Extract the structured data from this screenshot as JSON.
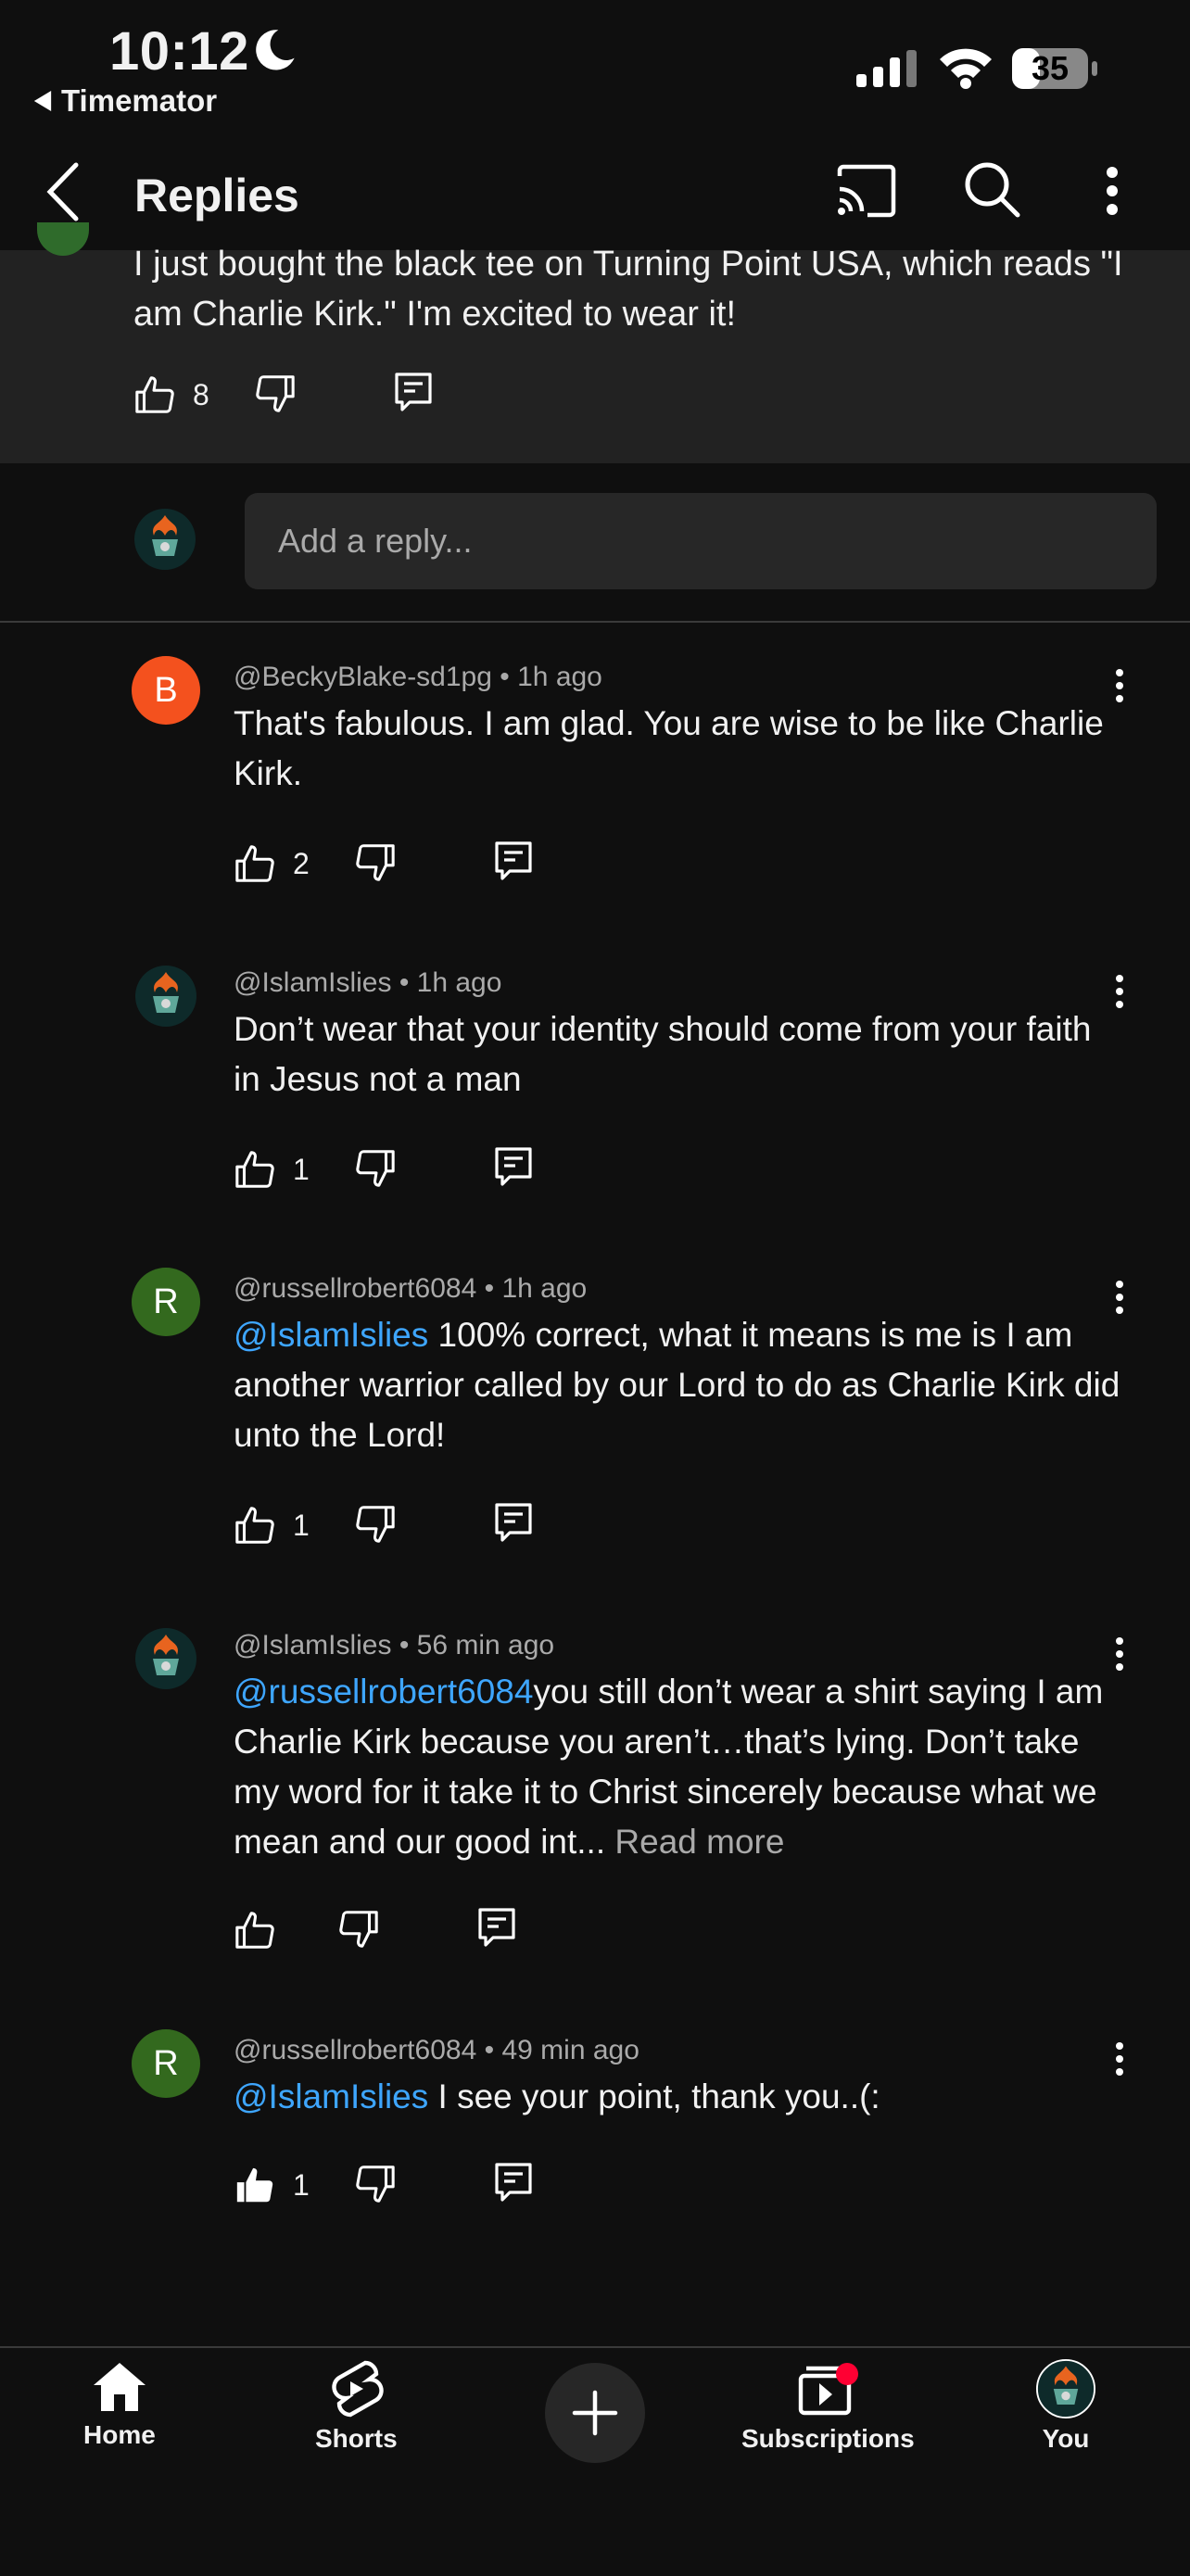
{
  "status_bar": {
    "time": "10:12",
    "back_app": "Timemator",
    "battery": "35"
  },
  "header": {
    "title": "Replies"
  },
  "parent_comment": {
    "text": "I just bought the black tee on Turning Point USA, which reads \"I am Charlie Kirk.\" I'm excited to wear it!",
    "likes": "8"
  },
  "reply_input": {
    "placeholder": "Add a reply..."
  },
  "replies": [
    {
      "avatar_letter": "B",
      "avatar_color": "#f4511e",
      "handle": "@BeckyBlake-sd1pg",
      "time": "1h ago",
      "mention": "",
      "text": "That's fabulous.  I am glad. You  are wise to be like Charlie Kirk.",
      "read_more": "",
      "likes": "2",
      "liked": false
    },
    {
      "avatar_letter": "",
      "avatar_color": "",
      "handle": "@IslamIslies",
      "time": "1h ago",
      "mention": "",
      "text": "Don’t wear that your identity should come from your faith in Jesus not a man",
      "read_more": "",
      "likes": "1",
      "liked": false
    },
    {
      "avatar_letter": "R",
      "avatar_color": "#33691e",
      "handle": "@russellrobert6084",
      "time": "1h ago",
      "mention": "@IslamIslies",
      "text": " 100% correct, what it means is me is I am another warrior called by our Lord to do as Charlie Kirk did unto the Lord!",
      "read_more": "",
      "likes": "1",
      "liked": false
    },
    {
      "avatar_letter": "",
      "avatar_color": "",
      "handle": "@IslamIslies",
      "time": "56 min ago",
      "mention": "@russellrobert6084",
      "text": "you still don’t wear a shirt saying I am Charlie Kirk because you aren’t…that’s lying. Don’t take my word for it take it to Christ sincerely because what we mean and our good int...",
      "read_more": "Read more",
      "likes": "",
      "liked": false
    },
    {
      "avatar_letter": "R",
      "avatar_color": "#33691e",
      "handle": "@russellrobert6084",
      "time": "49 min ago",
      "mention": "@IslamIslies",
      "text": " I see your point, thank you..(:",
      "read_more": "",
      "likes": "1",
      "liked": true
    }
  ],
  "bottom_nav": {
    "home": "Home",
    "shorts": "Shorts",
    "subscriptions": "Subscriptions",
    "you": "You"
  }
}
